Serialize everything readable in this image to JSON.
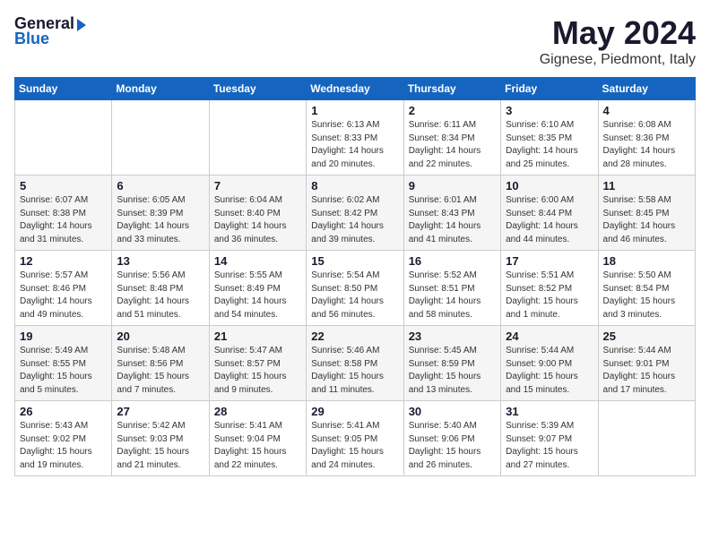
{
  "header": {
    "logo_general": "General",
    "logo_blue": "Blue",
    "title": "May 2024",
    "location": "Gignese, Piedmont, Italy"
  },
  "days_of_week": [
    "Sunday",
    "Monday",
    "Tuesday",
    "Wednesday",
    "Thursday",
    "Friday",
    "Saturday"
  ],
  "weeks": [
    [
      {
        "day": "",
        "content": ""
      },
      {
        "day": "",
        "content": ""
      },
      {
        "day": "",
        "content": ""
      },
      {
        "day": "1",
        "content": "Sunrise: 6:13 AM\nSunset: 8:33 PM\nDaylight: 14 hours\nand 20 minutes."
      },
      {
        "day": "2",
        "content": "Sunrise: 6:11 AM\nSunset: 8:34 PM\nDaylight: 14 hours\nand 22 minutes."
      },
      {
        "day": "3",
        "content": "Sunrise: 6:10 AM\nSunset: 8:35 PM\nDaylight: 14 hours\nand 25 minutes."
      },
      {
        "day": "4",
        "content": "Sunrise: 6:08 AM\nSunset: 8:36 PM\nDaylight: 14 hours\nand 28 minutes."
      }
    ],
    [
      {
        "day": "5",
        "content": "Sunrise: 6:07 AM\nSunset: 8:38 PM\nDaylight: 14 hours\nand 31 minutes."
      },
      {
        "day": "6",
        "content": "Sunrise: 6:05 AM\nSunset: 8:39 PM\nDaylight: 14 hours\nand 33 minutes."
      },
      {
        "day": "7",
        "content": "Sunrise: 6:04 AM\nSunset: 8:40 PM\nDaylight: 14 hours\nand 36 minutes."
      },
      {
        "day": "8",
        "content": "Sunrise: 6:02 AM\nSunset: 8:42 PM\nDaylight: 14 hours\nand 39 minutes."
      },
      {
        "day": "9",
        "content": "Sunrise: 6:01 AM\nSunset: 8:43 PM\nDaylight: 14 hours\nand 41 minutes."
      },
      {
        "day": "10",
        "content": "Sunrise: 6:00 AM\nSunset: 8:44 PM\nDaylight: 14 hours\nand 44 minutes."
      },
      {
        "day": "11",
        "content": "Sunrise: 5:58 AM\nSunset: 8:45 PM\nDaylight: 14 hours\nand 46 minutes."
      }
    ],
    [
      {
        "day": "12",
        "content": "Sunrise: 5:57 AM\nSunset: 8:46 PM\nDaylight: 14 hours\nand 49 minutes."
      },
      {
        "day": "13",
        "content": "Sunrise: 5:56 AM\nSunset: 8:48 PM\nDaylight: 14 hours\nand 51 minutes."
      },
      {
        "day": "14",
        "content": "Sunrise: 5:55 AM\nSunset: 8:49 PM\nDaylight: 14 hours\nand 54 minutes."
      },
      {
        "day": "15",
        "content": "Sunrise: 5:54 AM\nSunset: 8:50 PM\nDaylight: 14 hours\nand 56 minutes."
      },
      {
        "day": "16",
        "content": "Sunrise: 5:52 AM\nSunset: 8:51 PM\nDaylight: 14 hours\nand 58 minutes."
      },
      {
        "day": "17",
        "content": "Sunrise: 5:51 AM\nSunset: 8:52 PM\nDaylight: 15 hours\nand 1 minute."
      },
      {
        "day": "18",
        "content": "Sunrise: 5:50 AM\nSunset: 8:54 PM\nDaylight: 15 hours\nand 3 minutes."
      }
    ],
    [
      {
        "day": "19",
        "content": "Sunrise: 5:49 AM\nSunset: 8:55 PM\nDaylight: 15 hours\nand 5 minutes."
      },
      {
        "day": "20",
        "content": "Sunrise: 5:48 AM\nSunset: 8:56 PM\nDaylight: 15 hours\nand 7 minutes."
      },
      {
        "day": "21",
        "content": "Sunrise: 5:47 AM\nSunset: 8:57 PM\nDaylight: 15 hours\nand 9 minutes."
      },
      {
        "day": "22",
        "content": "Sunrise: 5:46 AM\nSunset: 8:58 PM\nDaylight: 15 hours\nand 11 minutes."
      },
      {
        "day": "23",
        "content": "Sunrise: 5:45 AM\nSunset: 8:59 PM\nDaylight: 15 hours\nand 13 minutes."
      },
      {
        "day": "24",
        "content": "Sunrise: 5:44 AM\nSunset: 9:00 PM\nDaylight: 15 hours\nand 15 minutes."
      },
      {
        "day": "25",
        "content": "Sunrise: 5:44 AM\nSunset: 9:01 PM\nDaylight: 15 hours\nand 17 minutes."
      }
    ],
    [
      {
        "day": "26",
        "content": "Sunrise: 5:43 AM\nSunset: 9:02 PM\nDaylight: 15 hours\nand 19 minutes."
      },
      {
        "day": "27",
        "content": "Sunrise: 5:42 AM\nSunset: 9:03 PM\nDaylight: 15 hours\nand 21 minutes."
      },
      {
        "day": "28",
        "content": "Sunrise: 5:41 AM\nSunset: 9:04 PM\nDaylight: 15 hours\nand 22 minutes."
      },
      {
        "day": "29",
        "content": "Sunrise: 5:41 AM\nSunset: 9:05 PM\nDaylight: 15 hours\nand 24 minutes."
      },
      {
        "day": "30",
        "content": "Sunrise: 5:40 AM\nSunset: 9:06 PM\nDaylight: 15 hours\nand 26 minutes."
      },
      {
        "day": "31",
        "content": "Sunrise: 5:39 AM\nSunset: 9:07 PM\nDaylight: 15 hours\nand 27 minutes."
      },
      {
        "day": "",
        "content": ""
      }
    ]
  ]
}
